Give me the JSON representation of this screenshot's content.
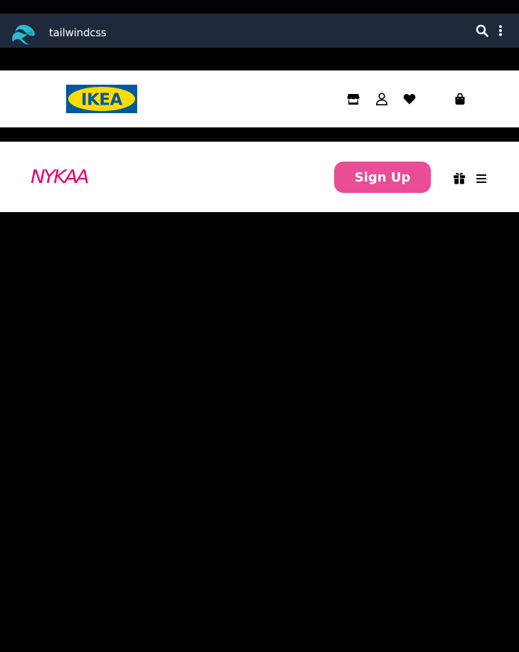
{
  "tailwind_bar": {
    "title": "tailwindcss",
    "icons": [
      "tailwind-logo-icon",
      "search-icon",
      "more-vertical-icon"
    ],
    "background": "#1e293b",
    "logo_color": "#38bdf8"
  },
  "ikea_bar": {
    "logo_text": "IKEA",
    "logo_colors": {
      "blue": "#0058a3",
      "yellow": "#ffdb00"
    },
    "icons": [
      "store-icon",
      "user-icon",
      "heart-icon",
      "shopping-bag-icon"
    ]
  },
  "nykaa_bar": {
    "logo_text": "NYKAA",
    "logo_color": "#e80071",
    "signup_label": "Sign Up",
    "signup_color": "#e84d96",
    "icons": [
      "gift-icon",
      "hamburger-menu-icon"
    ]
  }
}
